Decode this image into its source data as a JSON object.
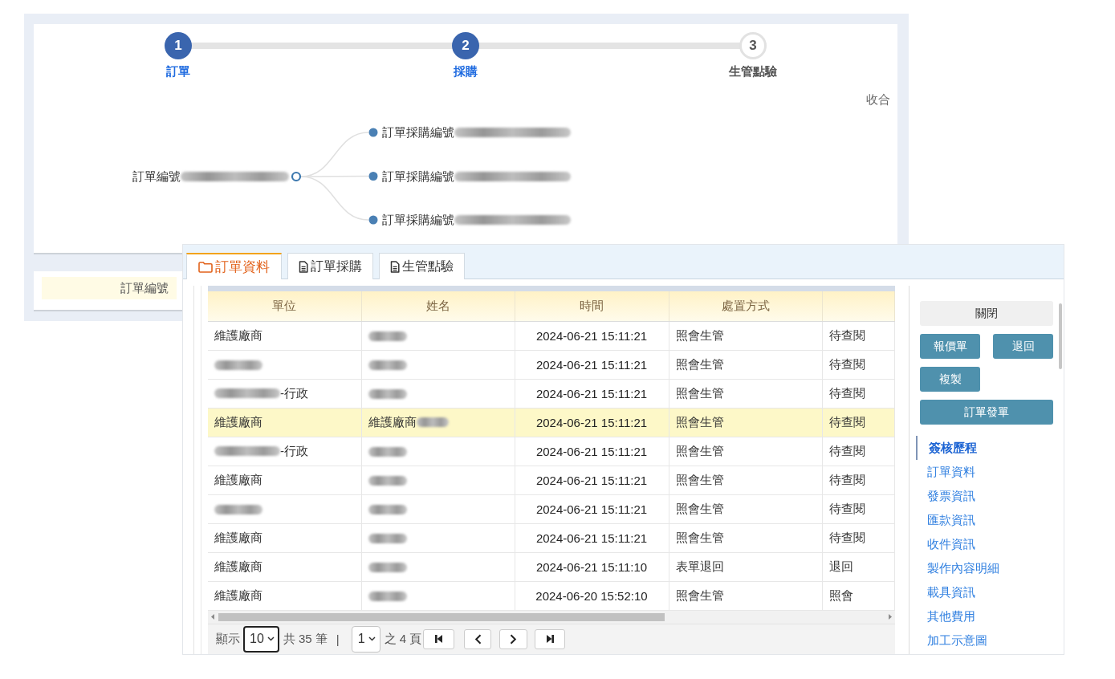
{
  "steps": [
    {
      "number": "1",
      "label": "訂單",
      "completed": true
    },
    {
      "number": "2",
      "label": "採購",
      "completed": true
    },
    {
      "number": "3",
      "label": "生管點驗",
      "completed": false
    }
  ],
  "collapse_link": "收合",
  "tree": {
    "root": {
      "text": "訂單編號",
      "blurred_after": true
    },
    "children": [
      {
        "text": "訂單採購編號",
        "blurred_after": true
      },
      {
        "text": "訂單採購編號",
        "blurred_after": true
      },
      {
        "text": "訂單採購編號",
        "blurred_after": true
      }
    ]
  },
  "summary_card": {
    "field_label": "訂單編號"
  },
  "tabs": [
    {
      "label": "訂單資料",
      "kind": "folder",
      "selected": true
    },
    {
      "label": "訂單採購",
      "kind": "document",
      "selected": false
    },
    {
      "label": "生管點驗",
      "kind": "document",
      "selected": false
    }
  ],
  "table": {
    "columns": [
      "單位",
      "姓名",
      "時間",
      "處置方式"
    ],
    "rows": [
      {
        "selected": false,
        "cells": [
          "維護廠商",
          {
            "blurred": true
          },
          "2024-06-21 15:11:21",
          "照會生管",
          "待查閱"
        ]
      },
      {
        "selected": false,
        "cells": [
          {
            "blurred": true
          },
          {
            "blurred": true
          },
          "2024-06-21 15:11:21",
          "照會生管",
          "待查閱"
        ]
      },
      {
        "selected": false,
        "cells": [
          {
            "text": "-行政",
            "blurred_before": true
          },
          {
            "blurred": true
          },
          "2024-06-21 15:11:21",
          "照會生管",
          "待查閱"
        ]
      },
      {
        "selected": true,
        "cells": [
          "維護廠商",
          {
            "text": "維護廠商",
            "blurred_after": true
          },
          "2024-06-21 15:11:21",
          "照會生管",
          "待查閱"
        ]
      },
      {
        "selected": false,
        "cells": [
          {
            "text": "-行政",
            "blurred_before": true
          },
          {
            "blurred": true
          },
          "2024-06-21 15:11:21",
          "照會生管",
          "待查閱"
        ]
      },
      {
        "selected": false,
        "cells": [
          "維護廠商",
          {
            "blurred": true
          },
          "2024-06-21 15:11:21",
          "照會生管",
          "待查閱"
        ]
      },
      {
        "selected": false,
        "cells": [
          {
            "blurred": true
          },
          {
            "blurred": true
          },
          "2024-06-21 15:11:21",
          "照會生管",
          "待查閱"
        ]
      },
      {
        "selected": false,
        "cells": [
          "維護廠商",
          {
            "blurred": true
          },
          "2024-06-21 15:11:21",
          "照會生管",
          "待查閱"
        ]
      },
      {
        "selected": false,
        "cells": [
          "維護廠商",
          {
            "blurred": true
          },
          "2024-06-21 15:11:10",
          "表單退回",
          "退回"
        ]
      },
      {
        "selected": false,
        "cells": [
          "維護廠商",
          {
            "blurred": true
          },
          "2024-06-20 15:52:10",
          "照會生管",
          "照會"
        ]
      }
    ]
  },
  "pagination": {
    "show_label": "顯示",
    "page_size": {
      "value": "10",
      "focused": true
    },
    "total": "共 35 筆",
    "divider": "|",
    "page": {
      "value": "1",
      "focused": false
    },
    "page_count": "之 4 頁"
  },
  "actions": [
    {
      "label": "關閉",
      "kind": "close"
    },
    {
      "label": "報價單",
      "kind": "action"
    },
    {
      "label": "退回",
      "kind": "action"
    },
    {
      "label": "複製",
      "kind": "action"
    },
    {
      "label": "訂單發單",
      "kind": "submit"
    }
  ],
  "sections": [
    {
      "label": "簽核歷程",
      "selected": true
    },
    {
      "label": "訂單資料",
      "selected": false
    },
    {
      "label": "發票資訊",
      "selected": false
    },
    {
      "label": "匯款資訊",
      "selected": false
    },
    {
      "label": "收件資訊",
      "selected": false
    },
    {
      "label": "製作內容明細",
      "selected": false
    },
    {
      "label": "載具資訊",
      "selected": false
    },
    {
      "label": "其他費用",
      "selected": false
    },
    {
      "label": "加工示意圖",
      "selected": false
    }
  ]
}
